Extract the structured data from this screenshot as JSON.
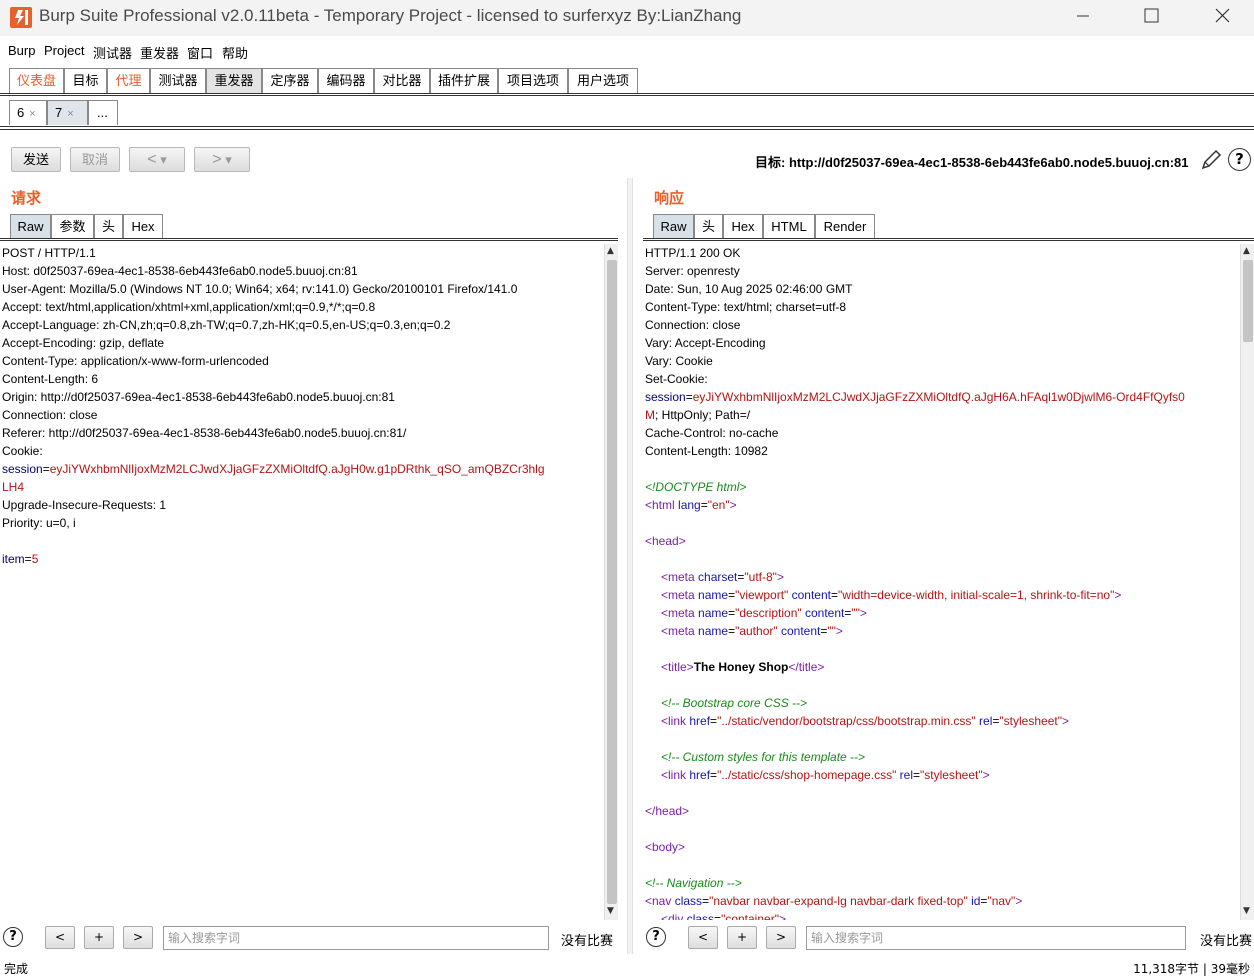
{
  "window": {
    "title": "Burp Suite Professional v2.0.11beta - Temporary Project - licensed to surferxyz By:LianZhang",
    "minimize": "—",
    "maximize": "☐",
    "close": "✕"
  },
  "menu": [
    "Burp",
    "Project",
    "测试器",
    "重发器",
    "窗口",
    "帮助"
  ],
  "main_tabs": [
    "仪表盘",
    "目标",
    "代理",
    "测试器",
    "重发器",
    "定序器",
    "编码器",
    "对比器",
    "插件扩展",
    "项目选项",
    "用户选项"
  ],
  "sub_tabs": [
    {
      "label": "6",
      "close": "×"
    },
    {
      "label": "7",
      "close": "×"
    },
    {
      "label": "..."
    }
  ],
  "toolbar": {
    "send": "发送",
    "cancel": "取消",
    "back": "<",
    "forward": ">",
    "dropdown": "▾",
    "target": "目标: http://d0f25037-69ea-4ec1-8538-6eb443fe6ab0.node5.buuoj.cn:81",
    "help": "?"
  },
  "request": {
    "title": "请求",
    "tabs": [
      "Raw",
      "参数",
      "头",
      "Hex"
    ],
    "lines": [
      "POST / HTTP/1.1",
      "Host: d0f25037-69ea-4ec1-8538-6eb443fe6ab0.node5.buuoj.cn:81",
      "User-Agent: Mozilla/5.0 (Windows NT 10.0; Win64; x64; rv:141.0) Gecko/20100101 Firefox/141.0",
      "Accept: text/html,application/xhtml+xml,application/xml;q=0.9,*/*;q=0.8",
      "Accept-Language: zh-CN,zh;q=0.8,zh-TW;q=0.7,zh-HK;q=0.5,en-US;q=0.3,en;q=0.2",
      "Accept-Encoding: gzip, deflate",
      "Content-Type: application/x-www-form-urlencoded",
      "Content-Length: 6",
      "Origin: http://d0f25037-69ea-4ec1-8538-6eb443fe6ab0.node5.buuoj.cn:81",
      "Connection: close",
      "Referer: http://d0f25037-69ea-4ec1-8538-6eb443fe6ab0.node5.buuoj.cn:81/",
      "Cookie:"
    ],
    "cookie_name": "session",
    "cookie_eq": "=",
    "cookie_value_1": "eyJiYWxhbmNlIjoxMzM2LCJwdXJjaGFzZXMiOltdfQ.aJgH0w.g1pDRthk_qSO_amQBZCr3hlg",
    "cookie_value_2": "LH4",
    "lines_after": [
      "Upgrade-Insecure-Requests: 1",
      "Priority: u=0, i"
    ],
    "body_name": "item",
    "body_eq": "=",
    "body_value": "5"
  },
  "response": {
    "title": "响应",
    "tabs": [
      "Raw",
      "头",
      "Hex",
      "HTML",
      "Render"
    ],
    "headers": [
      "HTTP/1.1 200 OK",
      "Server: openresty",
      "Date: Sun, 10 Aug 2025 02:46:00 GMT",
      "Content-Type: text/html; charset=utf-8",
      "Connection: close",
      "Vary: Accept-Encoding",
      "Vary: Cookie",
      "Set-Cookie:"
    ],
    "setcookie_name": "session",
    "setcookie_value_1": "eyJiYWxhbmNlIjoxMzM2LCJwdXJjaGFzZXMiOltdfQ.aJgH6A.hFAql1w0DjwlM6-Ord4FfQyfs0",
    "setcookie_value_2": "M",
    "setcookie_rest": "; HttpOnly; Path=/",
    "headers_after": [
      "Cache-Control: no-cache",
      "Content-Length: 10982"
    ]
  },
  "search": {
    "help": "?",
    "prev": "<",
    "add": "+",
    "next": ">",
    "placeholder": "输入搜索字词",
    "nomatch": "没有比赛"
  },
  "status": {
    "left": "完成",
    "right": "11,318字节 | 39毫秒"
  }
}
